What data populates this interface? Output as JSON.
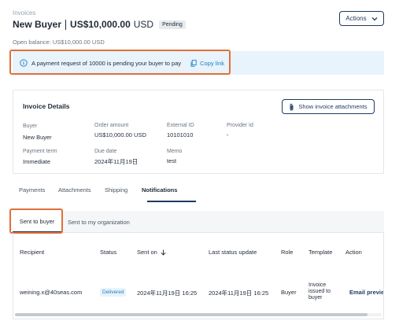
{
  "header": {
    "breadcrumb": "Invoices",
    "buyer_name": "New Buyer",
    "amount": "US$10,000.00",
    "currency": "USD",
    "status": "Pending",
    "actions_label": "Actions",
    "open_balance": "Open balance: US$10,000.00 USD"
  },
  "banner": {
    "message": "A payment request of 10000 is pending your buyer to pay",
    "copy_link_label": "Copy link",
    "info_icon": "info-icon",
    "copy_icon": "copy-icon"
  },
  "invoice_details": {
    "title": "Invoice Details",
    "show_attachments_label": "Show invoice attachments",
    "fields": {
      "buyer": {
        "label": "Buyer",
        "value": "New Buyer"
      },
      "order_amount": {
        "label": "Order amount",
        "value": "US$10,000.00  USD"
      },
      "external_id": {
        "label": "External ID",
        "value": "10101010"
      },
      "provider_id": {
        "label": "Provider Id",
        "value": "-"
      },
      "payment_term": {
        "label": "Payment term",
        "value": "Immediate"
      },
      "due_date": {
        "label": "Due date",
        "value": "2024年11月19日"
      },
      "memo": {
        "label": "Memo",
        "value": "test"
      }
    }
  },
  "tabs": [
    "Payments",
    "Attachments",
    "Shipping",
    "Notifications"
  ],
  "active_tab": "Notifications",
  "subtabs": {
    "active": "Sent to buyer",
    "other": "Sent to my organization"
  },
  "table": {
    "columns": [
      "Recipient",
      "Status",
      "Sent on",
      "Last status update",
      "Role",
      "Template",
      "Action"
    ],
    "rows": [
      {
        "recipient": "weining.x@40seas.com",
        "status": "Delivered",
        "sent_on": "2024年11月19日 16:25",
        "last_status_update": "2024年11月19日 16:25",
        "role": "Buyer",
        "template": "Invoice issued to buyer",
        "action": "Email preview"
      }
    ]
  },
  "colors": {
    "accent": "#1e3a5f",
    "link": "#1b7fc4",
    "banner_bg": "#e8f3fb",
    "highlight": "#e0703a"
  }
}
